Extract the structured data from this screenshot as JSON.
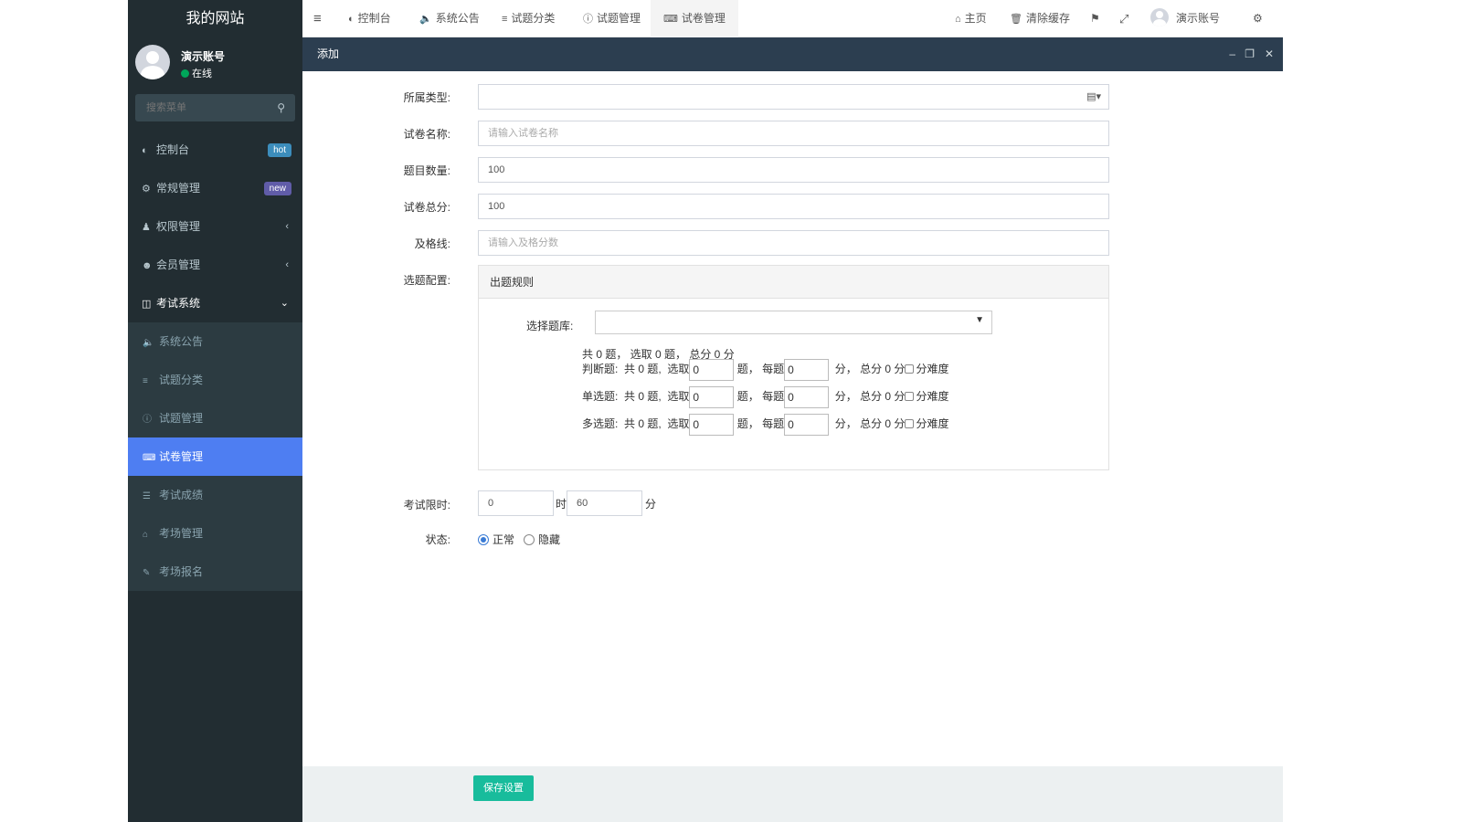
{
  "site": {
    "logo_text": "我的网站"
  },
  "user": {
    "name": "演示账号",
    "status": "在线"
  },
  "search": {
    "placeholder": "搜索菜单"
  },
  "sidebar": {
    "items": [
      {
        "label": "控制台",
        "icon": "dashboard-icon",
        "badge": "hot",
        "badge_color": "#3c8dbc"
      },
      {
        "label": "常规管理",
        "icon": "cogs-icon",
        "badge": "new",
        "badge_color": "#605ca8"
      },
      {
        "label": "权限管理",
        "icon": "group-icon",
        "arrow": "‹"
      },
      {
        "label": "会员管理",
        "icon": "user-circle-icon",
        "arrow": "‹"
      },
      {
        "label": "考试系统",
        "icon": "columns-icon",
        "arrow": "⌄"
      }
    ],
    "subitems": [
      {
        "label": "系统公告",
        "icon": "volume-icon"
      },
      {
        "label": "试题分类",
        "icon": "align-left-icon"
      },
      {
        "label": "试题管理",
        "icon": "question-icon"
      },
      {
        "label": "试卷管理",
        "icon": "keyboard-icon",
        "active": true
      },
      {
        "label": "考试成绩",
        "icon": "list-icon"
      },
      {
        "label": "考场管理",
        "icon": "home-icon"
      },
      {
        "label": "考场报名",
        "icon": "pencil-icon"
      }
    ]
  },
  "topnav": {
    "tabs": [
      {
        "label": "控制台"
      },
      {
        "label": "系统公告"
      },
      {
        "label": "试题分类"
      },
      {
        "label": "试题管理"
      },
      {
        "label": "试卷管理"
      }
    ],
    "home": "主页",
    "clear_cache": "清除缓存",
    "user": "演示账号"
  },
  "modal": {
    "title": "添加",
    "fields": {
      "type_label": "所属类型:",
      "name_label": "试卷名称:",
      "name_placeholder": "请输入试卷名称",
      "count_label": "题目数量:",
      "count_value": "100",
      "total_label": "试卷总分:",
      "total_value": "100",
      "pass_label": "及格线:",
      "pass_placeholder": "请输入及格分数",
      "config_label": "选题配置:",
      "rule_title": "出题规则",
      "bank_label": "选择题库:",
      "summary": "共 0 题， 选取 0 题， 总分 0 分",
      "limit_label": "考试限时:",
      "hours": "0",
      "hours_unit": "时",
      "minutes": "60",
      "minutes_unit": "分",
      "status_label": "状态:",
      "status_normal": "正常",
      "status_hidden": "隐藏"
    },
    "rules": [
      {
        "type": "判断题:",
        "total": "共 0 题,",
        "pick_label": "选取",
        "pick": "0",
        "each_label": "题， 每题",
        "each": "0",
        "sum": "分， 总分 0 分",
        "diff": "分难度"
      },
      {
        "type": "单选题:",
        "total": "共 0 题,",
        "pick_label": "选取",
        "pick": "0",
        "each_label": "题， 每题",
        "each": "0",
        "sum": "分， 总分 0 分",
        "diff": "分难度"
      },
      {
        "type": "多选题:",
        "total": "共 0 题,",
        "pick_label": "选取",
        "pick": "0",
        "each_label": "题， 每题",
        "each": "0",
        "sum": "分， 总分 0 分",
        "diff": "分难度"
      }
    ],
    "save_label": "保存设置"
  }
}
